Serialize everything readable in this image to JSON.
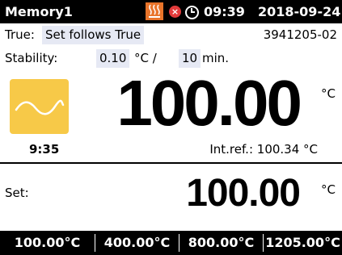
{
  "topbar": {
    "title": "Memory1",
    "time": "09:39",
    "date": "2018-09-24"
  },
  "info": {
    "true_label": "True:",
    "true_value": "Set follows True",
    "serial": "3941205-02",
    "stability_label": "Stability:",
    "stability_temp": "0.10",
    "stability_temp_unit": "°C /",
    "stability_time": "10",
    "stability_time_unit": "min."
  },
  "main": {
    "temperature": "100.00",
    "unit": "°C",
    "timer": "9:35",
    "int_ref": "Int.ref.: 100.34 °C"
  },
  "set": {
    "label": "Set:",
    "value": "100.00",
    "unit": "°C"
  },
  "presets": [
    "100.00°C",
    "400.00°C",
    "800.00°C",
    "1205.00°C"
  ],
  "icons": {
    "heater": "heater-icon",
    "alert": "alert-icon",
    "clock": "clock-icon",
    "stable_wave": "wave-icon"
  },
  "colors": {
    "heater": "#e8742a",
    "alert": "#e23b3b",
    "wave_tile": "#f7c948",
    "field_highlight": "#e6e9f4"
  }
}
